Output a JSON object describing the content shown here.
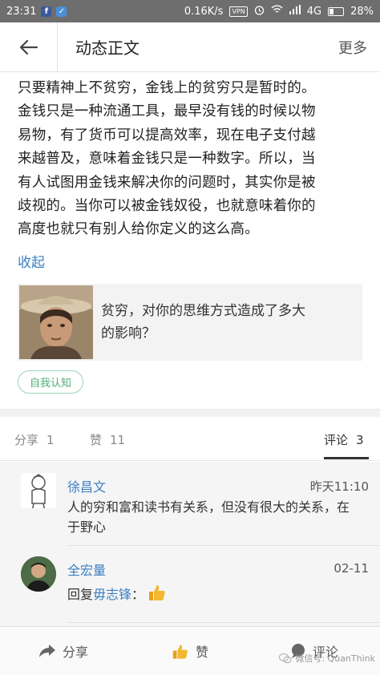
{
  "status_bar": {
    "time": "23:31",
    "network_speed": "0.16K/s",
    "vpn": "VPN",
    "network_type": "4G",
    "battery": "28%",
    "icons": [
      "facebook-icon",
      "shield-icon",
      "vpn-icon",
      "alarm-icon",
      "wifi-icon",
      "signal-icon",
      "battery-icon"
    ]
  },
  "header": {
    "title": "动态正文",
    "more_label": "更多"
  },
  "article": {
    "lines": [
      "只要精神上不贫穷，金钱上的贫穷只是暂时的。",
      "金钱只是一种流通工具，最早没有钱的时候以物",
      "易物，有了货币可以提高效率，现在电子支付越",
      "来越普及，意味着金钱只是一种数字。所以，当",
      "有人试图用金钱来解决你的问题时，其实你是被",
      "歧视的。当你可以被金钱奴役，也就意味着你的",
      "高度也就只有别人给你定义的这么高。"
    ],
    "collapse_label": "收起"
  },
  "linked_post": {
    "line1": "贫穷，对你的思维方式造成了多大",
    "line2": "的影响？"
  },
  "tag": "自我认知",
  "stats": {
    "share_label": "分享",
    "share_count": "1",
    "like_label": "赞",
    "like_count": "11",
    "comments_label": "评论",
    "comments_count": "3"
  },
  "comments": [
    {
      "name": "徐昌文",
      "time": "昨天11:10",
      "line1": "人的穷和富和读书有关系，但没有很大的关系，在",
      "line2": "于野心"
    },
    {
      "name": "全宏量",
      "time": "02-11",
      "reply_prefix": "回复",
      "reply_to": "毋志锋",
      "reply_suffix": "："
    }
  ],
  "bottom_bar": {
    "share_label": "分享",
    "like_label": "赞",
    "comment_label": "评论",
    "watermark": "微信号: QuanThink"
  },
  "colors": {
    "link_blue": "#3d7fc1",
    "tag_green": "#4caf7a",
    "status_bar_bg": "#6e6e6e"
  }
}
